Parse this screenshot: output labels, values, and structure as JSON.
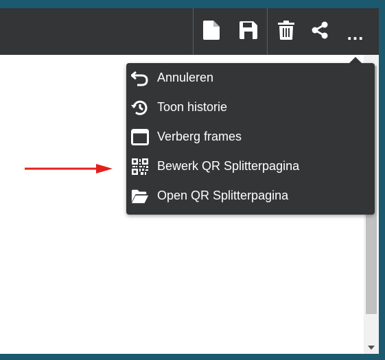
{
  "toolbar": {
    "buttons": [
      {
        "name": "new-document",
        "icon": "document-icon"
      },
      {
        "name": "save",
        "icon": "floppy-disk-icon"
      },
      {
        "name": "delete",
        "icon": "trash-icon"
      },
      {
        "name": "share",
        "icon": "share-icon"
      },
      {
        "name": "more",
        "label": "..."
      }
    ]
  },
  "menu": {
    "items": [
      {
        "label": "Annuleren",
        "icon": "undo-icon"
      },
      {
        "label": "Toon historie",
        "icon": "history-icon"
      },
      {
        "label": "Verberg frames",
        "icon": "window-frame-icon"
      },
      {
        "label": "Bewerk QR Splitterpagina",
        "icon": "qr-code-icon"
      },
      {
        "label": "Open QR Splitterpagina",
        "icon": "folder-open-icon"
      }
    ]
  },
  "annotation": {
    "arrow_color": "#e3201b",
    "points_to": "Bewerk QR Splitterpagina"
  },
  "colors": {
    "toolbar_bg": "#333537",
    "frame_bg": "#1b5a6e",
    "menu_bg": "#333537"
  }
}
